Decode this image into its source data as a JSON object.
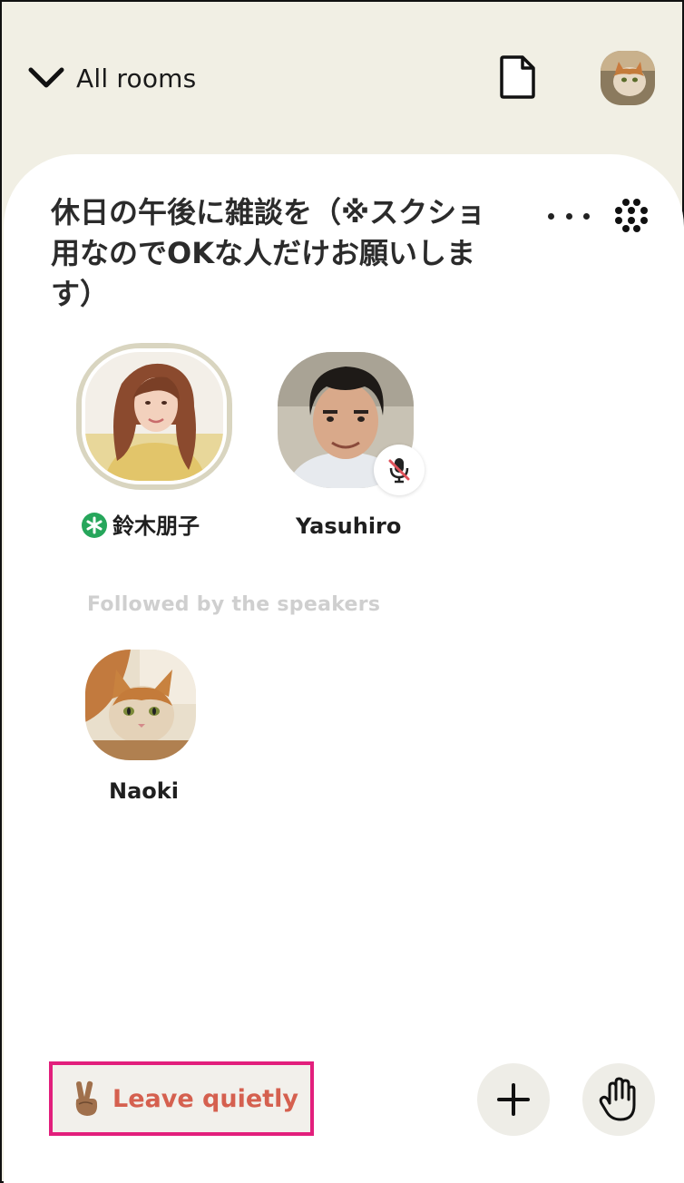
{
  "header": {
    "back_label": "All rooms",
    "icons": {
      "back": "chevron-down-icon",
      "document": "document-icon",
      "profile": "profile-avatar"
    }
  },
  "room": {
    "title": "休日の午後に雑談を（※スクショ用なのでOKな人だけお願いします）",
    "icons": {
      "more": "more-horizontal-icon",
      "grid": "dots-grid-icon"
    },
    "speakers": [
      {
        "name": "鈴木朋子",
        "moderator": true,
        "speaking": true,
        "muted": false
      },
      {
        "name": "Yasuhiro",
        "moderator": false,
        "speaking": false,
        "muted": true
      }
    ],
    "followed_label": "Followed by the speakers",
    "listeners": [
      {
        "name": "Naoki"
      }
    ]
  },
  "footer": {
    "leave_emoji": "✌🏽",
    "leave_label": "Leave quietly",
    "icons": {
      "add": "plus-icon",
      "hand": "raise-hand-icon"
    }
  },
  "colors": {
    "background": "#f1efe4",
    "card": "#ffffff",
    "leave_text": "#d5604f",
    "highlight_border": "#e21f7c",
    "moderator_badge": "#26a65b"
  }
}
